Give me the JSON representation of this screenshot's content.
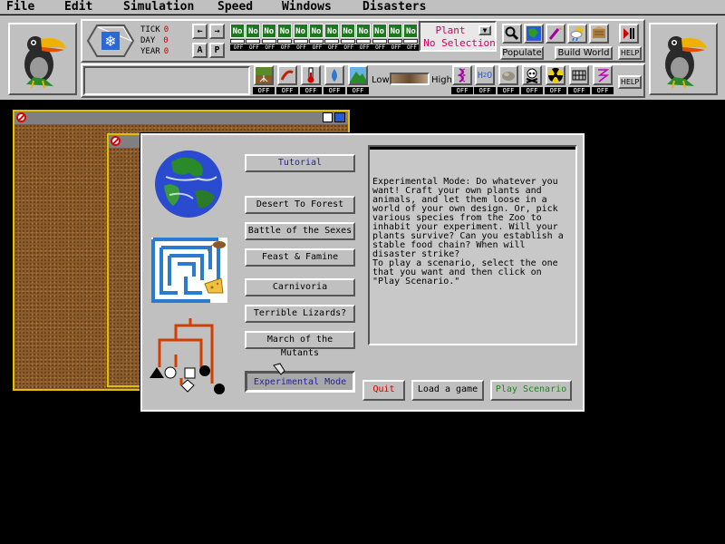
{
  "menubar": {
    "items": [
      "File",
      "Edit",
      "Simulation",
      "Speed",
      "Windows",
      "Disasters"
    ]
  },
  "time": {
    "tick_label": "TICK",
    "tick_value": "0",
    "day_label": "DAY",
    "day_value": "0",
    "year_label": "YEAR",
    "year_value": "0"
  },
  "nav": {
    "a_label": "A",
    "p_label": "P",
    "left_arrow": "←",
    "right_arrow": "→"
  },
  "species_toggles": {
    "no_label": "No",
    "off_label": "OFF",
    "count": 12
  },
  "selection": {
    "line1": "Plant",
    "line2": "No Selection"
  },
  "tools": {
    "populate": "Populate",
    "build_world": "Build World",
    "help": "HELP",
    "help2": "HELP"
  },
  "climate": {
    "low": "Low",
    "high": "High",
    "off_label": "OFF"
  },
  "dialog": {
    "tutorial": "Tutorial",
    "scenarios": [
      "Desert To Forest",
      "Battle of the Sexes",
      "Feast & Famine",
      "Carnivoria",
      "Terrible Lizards?",
      "March of the Mutants"
    ],
    "experimental": "Experimental Mode",
    "description": "Experimental Mode: Do whatever you\nwant! Craft your own plants and\nanimals, and let them loose in a\nworld of your own design. Or, pick\nvarious species from the Zoo to\ninhabit your experiment. Will your\nplants survive? Can you establish a\nstable food chain? When will\ndisaster strike?\nTo play a scenario, select the one\nthat you want and then click on\n\"Play Scenario.\"",
    "quit": "Quit",
    "load": "Load a game",
    "play": "Play Scenario"
  },
  "colors": {
    "panel": "#c0c0c0",
    "quit_text": "#d00000",
    "play_text": "#1a8a1a",
    "experimental_text": "#2a1aa0",
    "window_border": "#e0c000"
  }
}
